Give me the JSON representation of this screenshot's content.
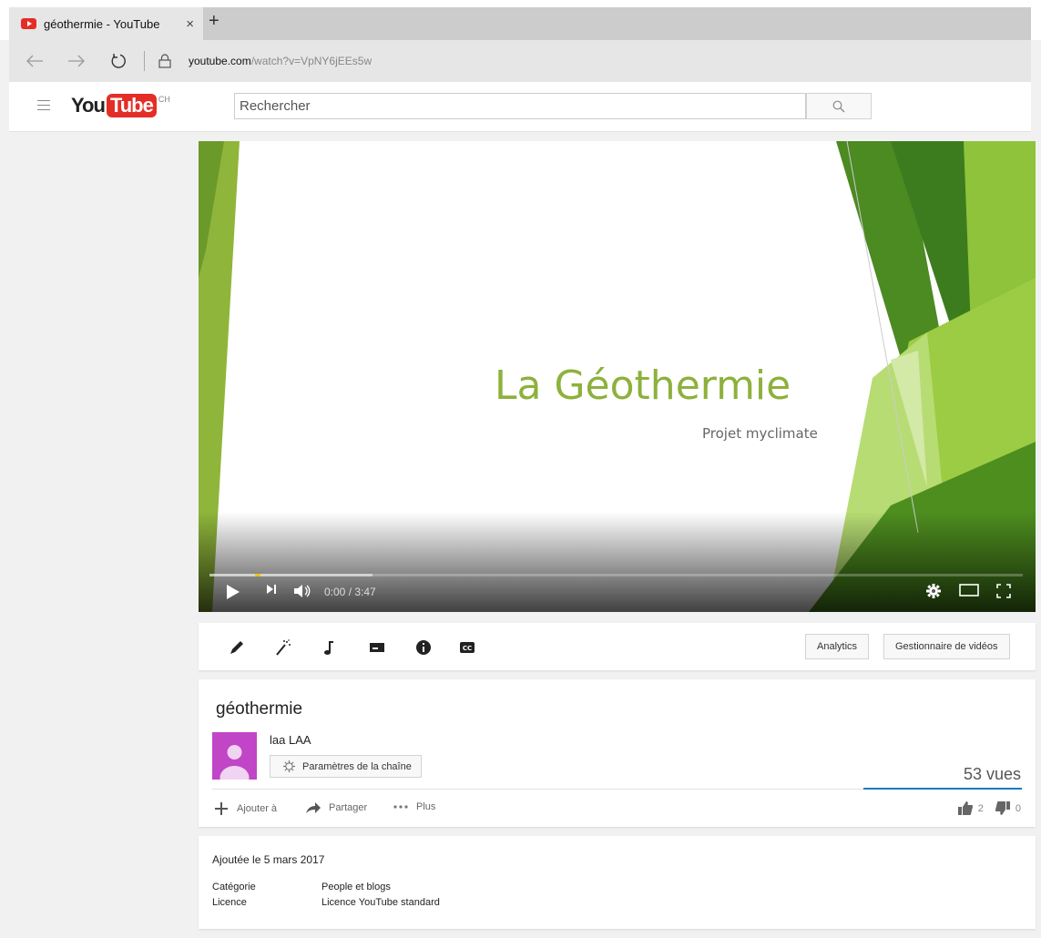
{
  "browser": {
    "tab_title": "géothermie - YouTube",
    "tab_close": "×",
    "new_tab": "+",
    "url_domain": "youtube.com",
    "url_path": "/watch?v=VpNY6jEEs5w"
  },
  "header": {
    "logo_you": "You",
    "logo_tube": "Tube",
    "country": "CH",
    "search_placeholder": "Rechercher"
  },
  "player": {
    "slide_title": "La Géothermie",
    "slide_subtitle": "Projet myclimate",
    "time": "0:00 / 3:47",
    "buffered_fraction": 0.2
  },
  "toolbar": {
    "tools": [
      "edit-icon",
      "enhance-wand-icon",
      "audio-note-icon",
      "annotations-icon",
      "info-cards-icon",
      "subtitles-cc-icon"
    ],
    "analytics_label": "Analytics",
    "video_manager_label": "Gestionnaire de vidéos"
  },
  "video": {
    "title": "géothermie",
    "channel_name": "laa LAA",
    "channel_settings_label": "Paramètres de la chaîne",
    "views": "53 vues",
    "add_to_label": "Ajouter à",
    "share_label": "Partager",
    "more_label": "Plus",
    "likes": "2",
    "dislikes": "0"
  },
  "description": {
    "published": "Ajoutée le 5 mars 2017",
    "category_label": "Catégorie",
    "category_value": "People et blogs",
    "license_label": "Licence",
    "license_value": "Licence YouTube standard"
  },
  "colors": {
    "youtube_red": "#e52d27",
    "slide_green": "#8db13c",
    "like_bar": "#167ac6",
    "avatar": "#c145c7"
  }
}
